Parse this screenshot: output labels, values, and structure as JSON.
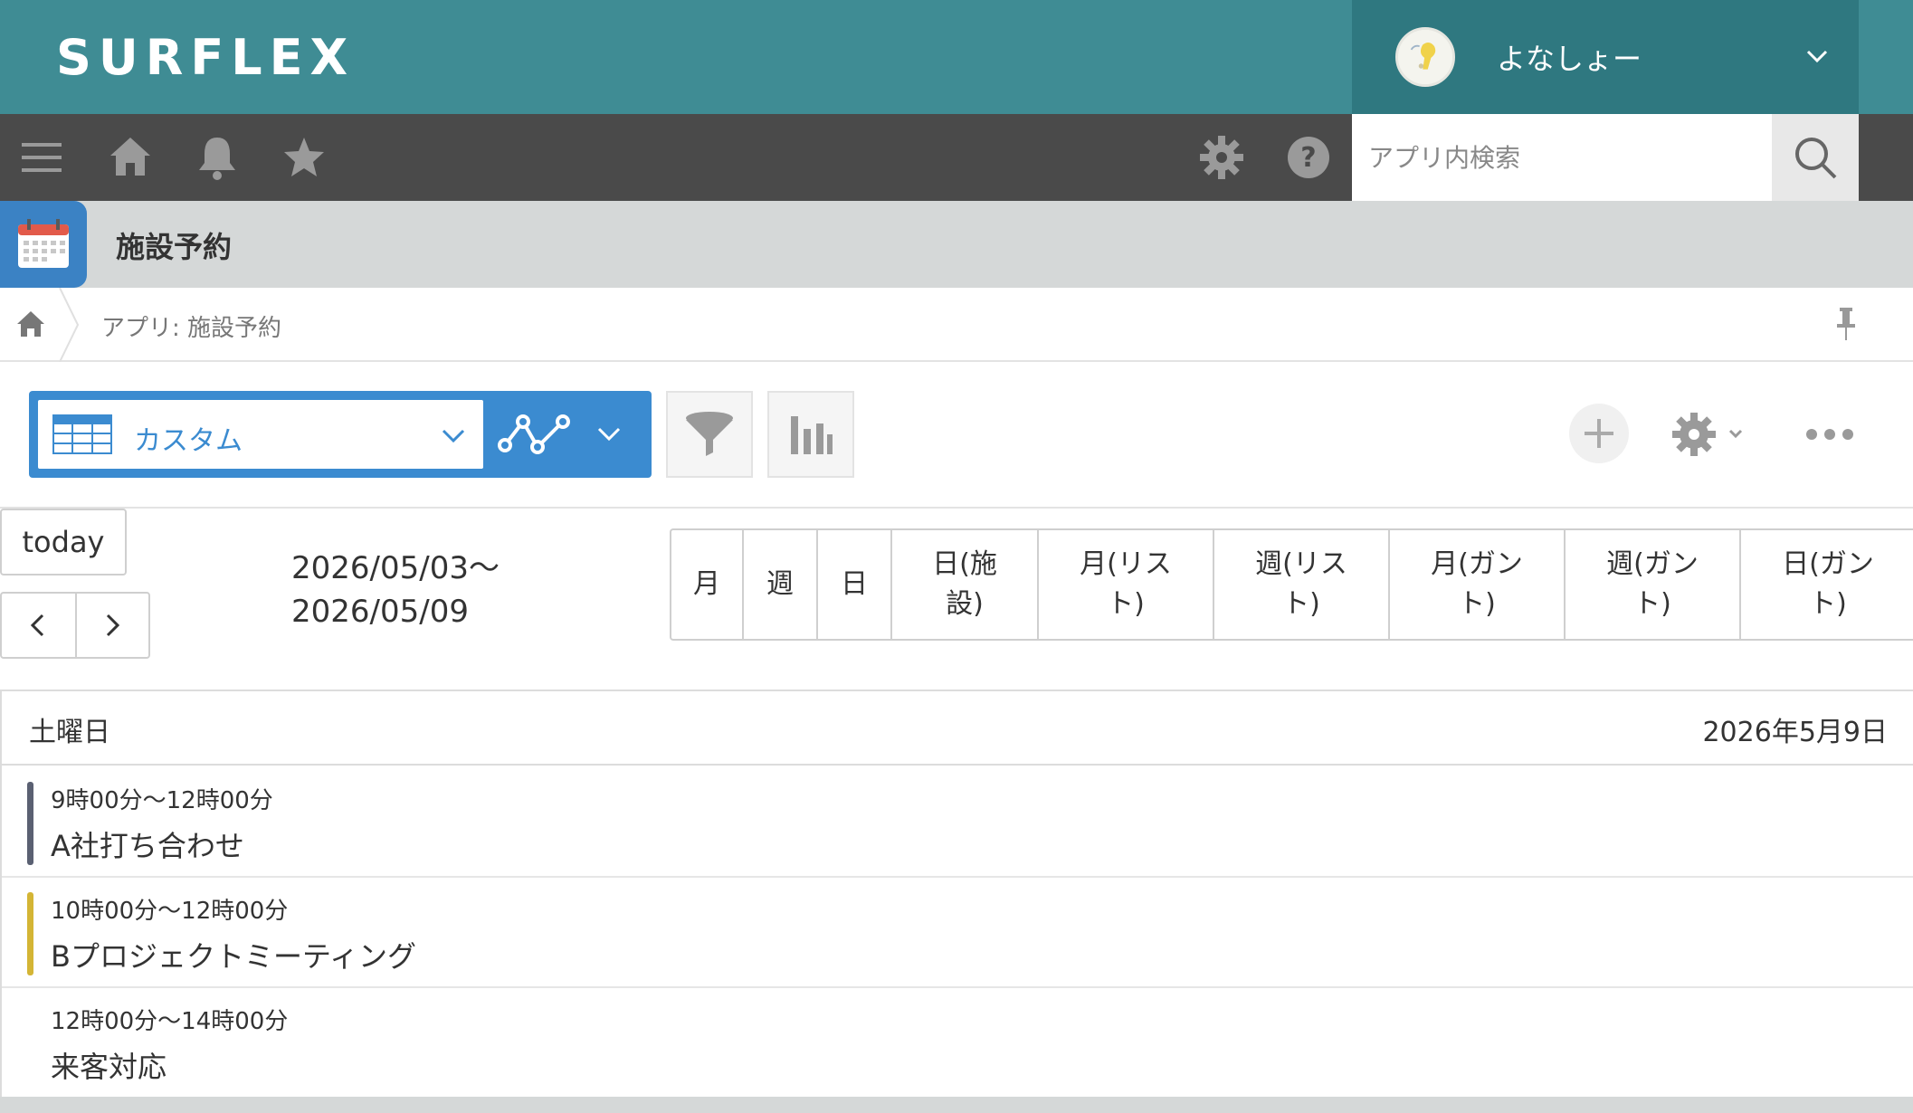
{
  "header": {
    "logo": "SURFLEX",
    "user_name": "よなしょー"
  },
  "toolbar": {
    "icons": [
      "menu-icon",
      "home-icon",
      "bell-icon",
      "star-icon",
      "gear-icon",
      "help-icon"
    ],
    "search_placeholder": "アプリ内検索"
  },
  "app": {
    "title": "施設予約"
  },
  "breadcrumb": {
    "path": "アプリ: 施設予約"
  },
  "view_bar": {
    "selected_view": "カスタム"
  },
  "calendar": {
    "today_label": "today",
    "date_range": "2026/05/03〜\n2026/05/09",
    "view_tabs": [
      {
        "label": "月",
        "width": 80
      },
      {
        "label": "週",
        "width": 82
      },
      {
        "label": "日",
        "width": 82
      },
      {
        "label": "日(施\n設)",
        "width": 162
      },
      {
        "label": "月(リス\nト)",
        "width": 194
      },
      {
        "label": "週(リス\nト)",
        "width": 194
      },
      {
        "label": "月(ガン\nト)",
        "width": 194
      },
      {
        "label": "週(ガン\nト)",
        "width": 194
      },
      {
        "label": "日(ガン\nト)",
        "width": 194
      }
    ]
  },
  "day": {
    "name": "土曜日",
    "date": "2026年5月9日",
    "events": [
      {
        "time": "9時00分〜12時00分",
        "title": "A社打ち合わせ",
        "color": "#5a6072"
      },
      {
        "time": "10時00分〜12時00分",
        "title": "Bプロジェクトミーティング",
        "color": "#d4b535"
      },
      {
        "time": "12時00分〜14時00分",
        "title": "来客対応",
        "color": ""
      }
    ]
  },
  "colors": {
    "header_bg": "#3f8c94",
    "user_area_bg": "#2f7880",
    "toolbar_bg": "#4a4a4a",
    "accent_blue": "#3b8bd0",
    "app_band_bg": "#d5d8d8"
  }
}
